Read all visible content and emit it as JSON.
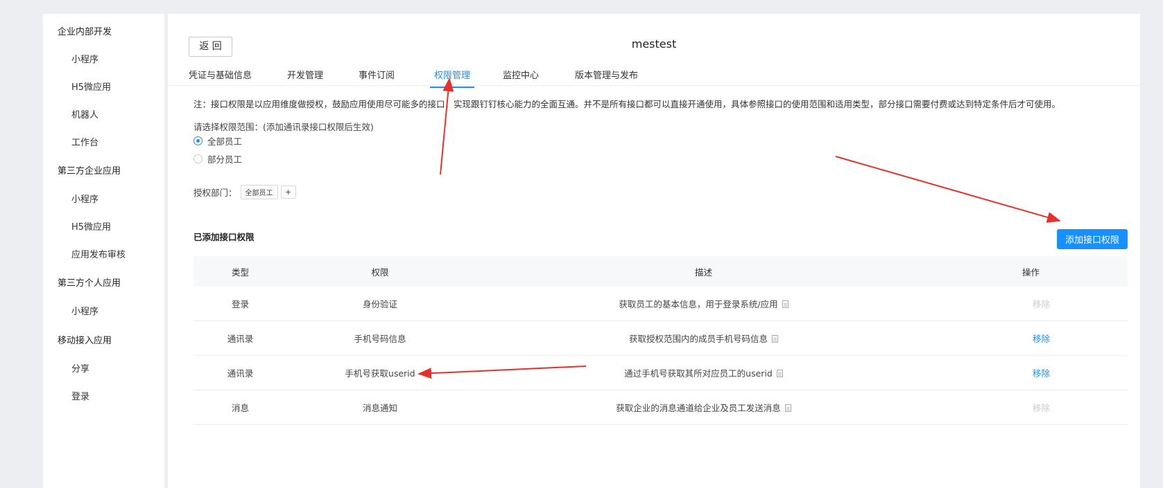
{
  "sidebar": {
    "groups": [
      {
        "label": "企业内部开发",
        "items": [
          "小程序",
          "H5微应用",
          "机器人",
          "工作台"
        ]
      },
      {
        "label": "第三方企业应用",
        "items": [
          "小程序",
          "H5微应用",
          "应用发布审核"
        ]
      },
      {
        "label": "第三方个人应用",
        "items": [
          "小程序"
        ]
      },
      {
        "label": "移动接入应用",
        "items": [
          "分享",
          "登录"
        ]
      }
    ]
  },
  "header": {
    "back_label": "返 回",
    "app_name": "mestest"
  },
  "tabs": [
    {
      "label": "凭证与基础信息",
      "active": false
    },
    {
      "label": "开发管理",
      "active": false
    },
    {
      "label": "事件订阅",
      "active": false
    },
    {
      "label": "权限管理",
      "active": true
    },
    {
      "label": "监控中心",
      "active": false
    },
    {
      "label": "版本管理与发布",
      "active": false
    }
  ],
  "note": "注：接口权限是以应用维度做授权，鼓励应用使用尽可能多的接口，实现跟钉钉核心能力的全面互通。并不是所有接口都可以直接开通使用，具体参照接口的使用范围和适用类型，部分接口需要付费或达到特定条件后才可使用。",
  "scope": {
    "label": "请选择权限范围：(添加通讯录接口权限后生效)",
    "options": [
      {
        "label": "全部员工",
        "checked": true
      },
      {
        "label": "部分员工",
        "checked": false
      }
    ]
  },
  "dept": {
    "label": "授权部门：",
    "tag": "全部员工",
    "add": "+"
  },
  "section_title": "已添加接口权限",
  "add_button": "添加接口权限",
  "table": {
    "headers": [
      "类型",
      "权限",
      "描述",
      "操作"
    ],
    "rows": [
      {
        "type": "登录",
        "perm": "身份验证",
        "desc": "获取员工的基本信息，用于登录系统/应用",
        "op": "移除",
        "op_enabled": false
      },
      {
        "type": "通讯录",
        "perm": "手机号码信息",
        "desc": "获取授权范围内的成员手机号码信息",
        "op": "移除",
        "op_enabled": true
      },
      {
        "type": "通讯录",
        "perm": "手机号获取userid",
        "desc": "通过手机号获取其所对应员工的userid",
        "op": "移除",
        "op_enabled": true
      },
      {
        "type": "消息",
        "perm": "消息通知",
        "desc": "获取企业的消息通道给企业及员工发送消息",
        "op": "移除",
        "op_enabled": false
      }
    ]
  },
  "colors": {
    "accent": "#1890ff",
    "arrow": "#e8302a",
    "disabled": "#cccccc"
  }
}
